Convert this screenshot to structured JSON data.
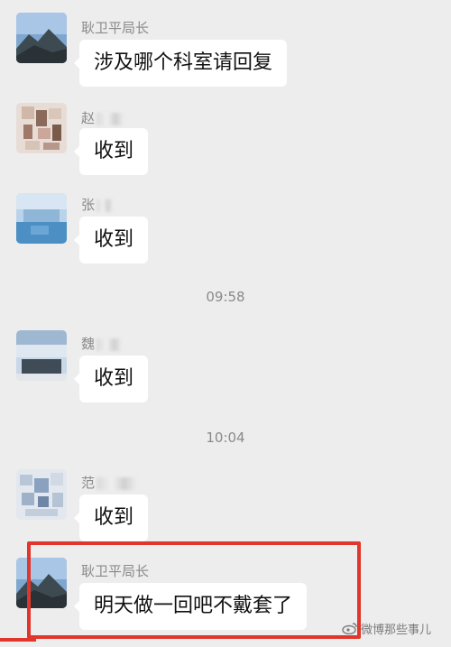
{
  "messages": [
    {
      "sender": "耿卫平局长",
      "text": "涉及哪个科室请回复"
    },
    {
      "sender": "赵",
      "text": "收到"
    },
    {
      "sender": "张",
      "text": "收到"
    },
    {
      "time": "09:58"
    },
    {
      "sender": "魏",
      "text": "收到"
    },
    {
      "time": "10:04"
    },
    {
      "sender": "范",
      "text": "收到"
    },
    {
      "sender": "耿卫平局长",
      "text": "明天做一回吧不戴套了"
    }
  ],
  "watermark": "微博那些事儿",
  "colors": {
    "background": "#ededed",
    "bubble": "#ffffff",
    "highlight": "#e0362c",
    "meta_text": "#8a8a8a"
  }
}
